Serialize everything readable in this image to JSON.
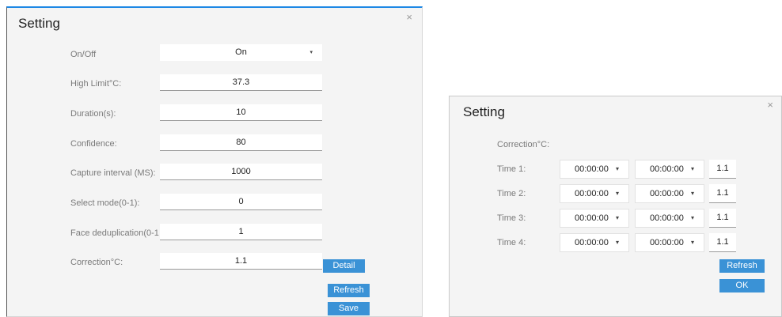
{
  "left_dialog": {
    "title": "Setting",
    "close": "×",
    "rows": [
      {
        "label": "On/Off",
        "value": "On",
        "caret": "▾"
      },
      {
        "label": "High Limit°C:",
        "value": "37.3"
      },
      {
        "label": "Duration(s):",
        "value": "10"
      },
      {
        "label": "Confidence:",
        "value": "80"
      },
      {
        "label": "Capture interval (MS):",
        "value": "1000"
      },
      {
        "label": "Select mode(0-1):",
        "value": "0"
      },
      {
        "label": "Face deduplication(0-1",
        "value": "1"
      },
      {
        "label": "Correction°C:",
        "value": "1.1"
      }
    ],
    "detail_label": "Detail",
    "refresh_label": "Refresh",
    "save_label": "Save"
  },
  "right_dialog": {
    "title": "Setting",
    "close": "×",
    "correction_label": "Correction°C:",
    "caret": "▾",
    "times": [
      {
        "label": "Time 1:",
        "start": "00:00:00",
        "end": "00:00:00",
        "value": "1.1"
      },
      {
        "label": "Time 2:",
        "start": "00:00:00",
        "end": "00:00:00",
        "value": "1.1"
      },
      {
        "label": "Time 3:",
        "start": "00:00:00",
        "end": "00:00:00",
        "value": "1.1"
      },
      {
        "label": "Time 4:",
        "start": "00:00:00",
        "end": "00:00:00",
        "value": "1.1"
      }
    ],
    "refresh_label": "Refresh",
    "ok_label": "OK"
  },
  "colors": {
    "accent": "#3a92d6",
    "titlebar_line": "#1e88e5",
    "dialog_bg": "#f4f4f4"
  }
}
